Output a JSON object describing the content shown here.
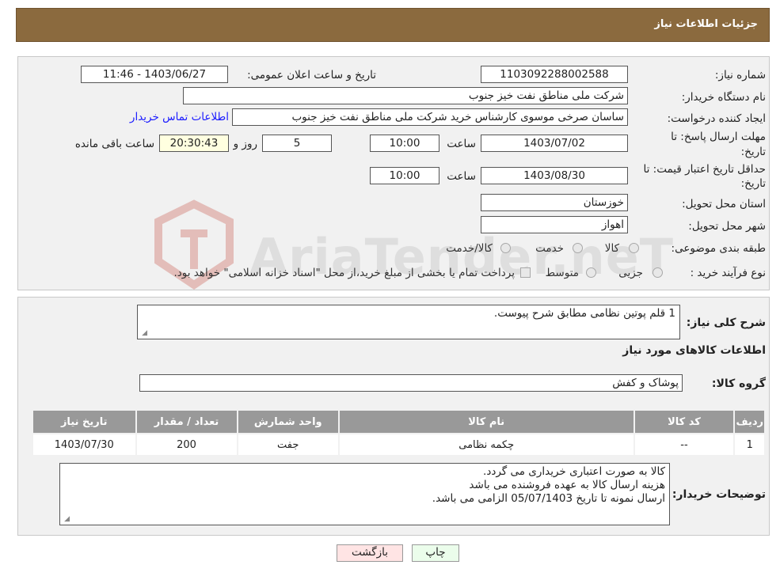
{
  "header": {
    "title": "جزئیات اطلاعات نیاز"
  },
  "form": {
    "need_number_label": "شماره نیاز:",
    "need_number": "1103092288002588",
    "announce_label": "تاریخ و ساعت اعلان عمومی:",
    "announce_value": "1403/06/27 - 11:46",
    "buyer_org_label": "نام دستگاه خریدار:",
    "buyer_org": "شرکت ملی مناطق نفت خیز جنوب",
    "requester_label": "ایجاد کننده درخواست:",
    "requester": "ساسان صرخی موسوی کارشناس خرید  شرکت ملی مناطق نفت خیز جنوب",
    "contact_link": "اطلاعات تماس خریدار",
    "reply_deadline_label_1": "مهلت ارسال پاسخ: تا",
    "reply_deadline_label_2": "تاریخ:",
    "reply_date": "1403/07/02",
    "time_word": "ساعت",
    "reply_time": "10:00",
    "days_value": "5",
    "days_word": "روز و",
    "remaining_time": "20:30:43",
    "remaining_word": "ساعت باقی مانده",
    "price_validity_label_1": "حداقل تاریخ اعتبار قیمت: تا",
    "price_validity_label_2": "تاریخ:",
    "price_date": "1403/08/30",
    "price_time": "10:00",
    "province_label": "استان محل تحویل:",
    "province": "خوزستان",
    "city_label": "شهر محل تحویل:",
    "city": "اهواز",
    "category_label": "طبقه بندی موضوعی:",
    "category_options": [
      "کالا",
      "خدمت",
      "کالا/خدمت"
    ],
    "process_label": "نوع فرآیند خرید :",
    "process_options": [
      "جزیی",
      "متوسط"
    ],
    "payment_note": "پرداخت تمام یا بخشی از مبلغ خرید،از محل \"اسناد خزانه اسلامی\" خواهد بود."
  },
  "watermark": {
    "text": "AriaTender.neT"
  },
  "description": {
    "label": "شرح کلی نیاز:",
    "value": "1 قلم پوتین نظامی مطابق شرح پیوست."
  },
  "goods": {
    "section_title": "اطلاعات کالاهای مورد نیاز",
    "group_label": "گروه کالا:",
    "group_value": "پوشاک و کفش",
    "columns": [
      "ردیف",
      "کد کالا",
      "نام کالا",
      "واحد شمارش",
      "تعداد / مقدار",
      "تاریخ نیاز"
    ],
    "rows": [
      [
        "1",
        "--",
        "چکمه نظامی",
        "جفت",
        "200",
        "1403/07/30"
      ]
    ]
  },
  "buyer_notes": {
    "label": "توضیحات خریدار:",
    "lines": [
      "کالا به صورت اعتباری خریداری می گردد.",
      "هزینه ارسال کالا به عهده فروشنده می باشد",
      "ارسال نمونه تا تاریخ 05/07/1403 الزامی می باشد."
    ]
  },
  "buttons": {
    "print": "چاپ",
    "back": "بازگشت"
  },
  "colors": {
    "header_bg": "#8b6a3e",
    "table_header_bg": "#999999",
    "back_button_bg": "#ffe4e4",
    "print_button_bg": "#ebfdeb",
    "watermark": "#c0392b"
  }
}
